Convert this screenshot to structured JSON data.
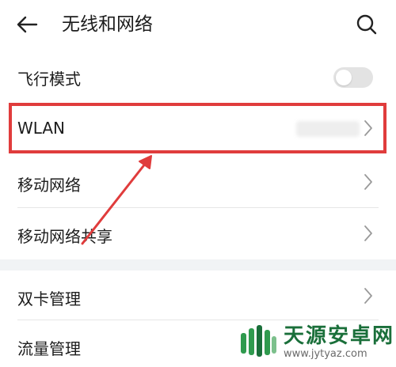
{
  "header": {
    "title": "无线和网络",
    "back_icon": "arrow-left-icon",
    "search_icon": "search-icon"
  },
  "rows": [
    {
      "label": "飞行模式",
      "control": "toggle",
      "toggle_on": false
    },
    {
      "label": "WLAN",
      "control": "chevron",
      "value": ""
    },
    {
      "label": "移动网络",
      "control": "chevron"
    },
    {
      "label": "移动网络共享",
      "control": "chevron"
    },
    {
      "label": "双卡管理",
      "control": "chevron"
    },
    {
      "label": "流量管理",
      "control": "chevron"
    }
  ],
  "annotation": {
    "highlight_color": "#e03c3c",
    "target": "WLAN"
  },
  "watermark": {
    "main": "天源安卓网",
    "url": "www.jytyaz.com",
    "color": "#1a6f3a"
  }
}
